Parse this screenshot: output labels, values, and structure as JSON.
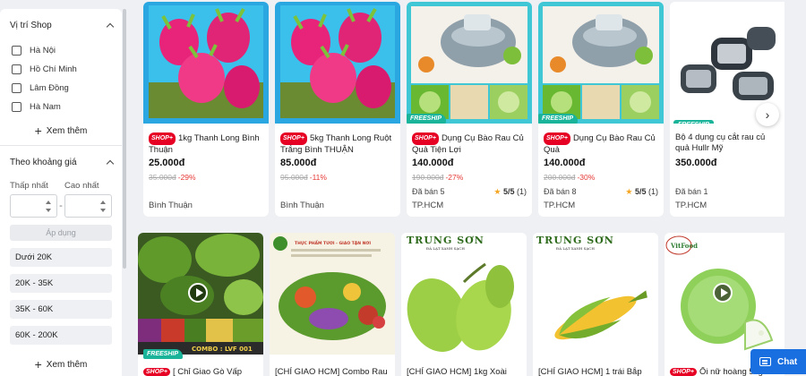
{
  "sidebar": {
    "location": {
      "heading": "Vị trí Shop",
      "items": [
        "Hà Nội",
        "Hồ Chí Minh",
        "Lâm Đồng",
        "Hà Nam"
      ],
      "more_label": "Xem thêm"
    },
    "price": {
      "heading": "Theo khoảng giá",
      "min_label": "Thấp nhất",
      "max_label": "Cao nhất",
      "range_sep": "-",
      "apply_label": "Áp dụng",
      "ranges": [
        "Dưới 20K",
        "20K - 35K",
        "35K - 60K",
        "60K - 200K"
      ],
      "more_label": "Xem thêm"
    }
  },
  "badges": {
    "shop": "SHOP+",
    "freeship": "FREESHIP"
  },
  "products_row1": [
    {
      "title": "1kg Thanh Long Bình Thuận",
      "price": "25.000đ",
      "old_price": "35.000đ",
      "discount": "-29%",
      "sold": "",
      "rating": "",
      "rating_count": "",
      "location": "Bình Thuận",
      "freeship": false
    },
    {
      "title": "5kg Thanh Long Ruột Trắng Bình THUẬN",
      "price": "85.000đ",
      "old_price": "95.000đ",
      "discount": "-11%",
      "sold": "",
      "rating": "",
      "rating_count": "",
      "location": "Bình Thuận",
      "freeship": false
    },
    {
      "title": "Dụng Cụ Bào Rau Củ Quả Tiện Lợi",
      "price": "140.000đ",
      "old_price": "190.000đ",
      "discount": "-27%",
      "sold": "Đã bán 5",
      "rating": "5/5",
      "rating_count": "(1)",
      "location": "TP.HCM",
      "freeship": true
    },
    {
      "title": "Dụng Cụ Bào Rau Củ Quả",
      "price": "140.000đ",
      "old_price": "200.000đ",
      "discount": "-30%",
      "sold": "Đã bán 8",
      "rating": "5/5",
      "rating_count": "(1)",
      "location": "TP.HCM",
      "freeship": true
    },
    {
      "title": "Bộ 4 dụng cụ cắt rau củ quả Hullr Mỹ",
      "price": "350.000đ",
      "old_price": "",
      "discount": "",
      "sold": "Đã bán 1",
      "rating": "",
      "rating_count": "",
      "location": "TP.HCM",
      "freeship": true
    }
  ],
  "products_row2": [
    {
      "title": "[ Chỉ Giao Gò Vấp",
      "image_text": "COMBO : LVF 001",
      "freeship": true
    },
    {
      "title": "[CHỈ GIAO HCM] Combo Rau",
      "image_text": "THỰC PHẨM TƯƠI - GIAO TẬN NƠI"
    },
    {
      "title": "[CHỈ GIAO HCM] 1kg Xoài",
      "brand": "TRUNG SƠN",
      "brand_sub": "ĐÀ LẠT XANH SẠCH"
    },
    {
      "title": "[CHỈ GIAO HCM] 1 trái Bắp",
      "brand": "TRUNG SƠN",
      "brand_sub": "ĐÀ LẠT XANH SẠCH"
    },
    {
      "title": "Ổi nữ hoàng 5kg",
      "brand": "VitFood"
    }
  ],
  "chat": {
    "label": "Chat"
  },
  "colors": {
    "accent": "#1a6fe0",
    "freeship": "#19b49a",
    "shop_badge": "#e60023",
    "discount": "#e53935"
  }
}
